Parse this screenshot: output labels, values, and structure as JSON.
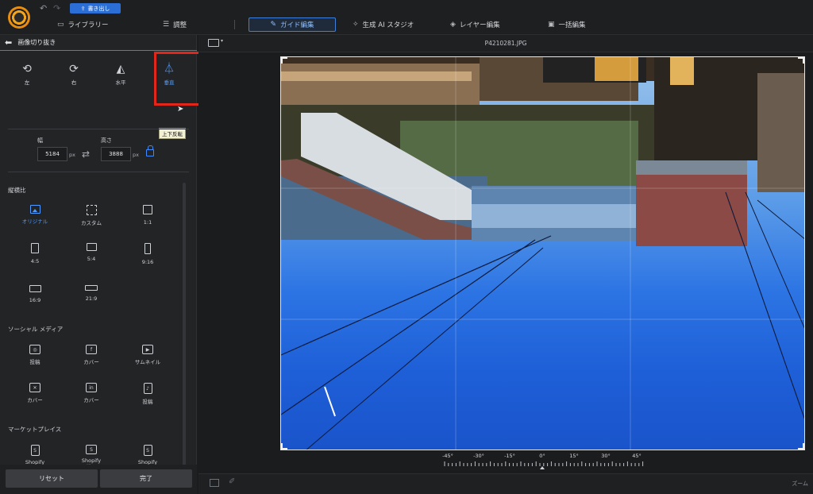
{
  "header": {
    "undo_icon": "↶",
    "redo_icon": "↷",
    "export_label": "書き出し",
    "tabs": [
      {
        "label": "ライブラリー",
        "icon": "library-icon"
      },
      {
        "label": "調整",
        "icon": "sliders-icon"
      },
      {
        "label": "ガイド編集",
        "icon": "wand-icon",
        "active": true
      },
      {
        "label": "生成 AI スタジオ",
        "icon": "sparkle-icon"
      },
      {
        "label": "レイヤー編集",
        "icon": "layers-icon"
      },
      {
        "label": "一括編集",
        "icon": "batch-icon"
      }
    ]
  },
  "left_panel": {
    "title": "画像切り抜き",
    "tools": [
      {
        "label": "左",
        "icon": "rotate-left-icon"
      },
      {
        "label": "右",
        "icon": "rotate-right-icon"
      },
      {
        "label": "水平",
        "icon": "flip-horizontal-icon"
      },
      {
        "label": "垂直",
        "icon": "flip-vertical-icon",
        "active": true
      }
    ],
    "tooltip": "上下反転",
    "width_label": "幅",
    "height_label": "高さ",
    "width_value": "5184",
    "height_value": "3888",
    "unit": "px",
    "aspect_section": "縦横比",
    "aspect_options": [
      {
        "label": "オリジナル",
        "active": true
      },
      {
        "label": "カスタム"
      },
      {
        "label": "1:1"
      },
      {
        "label": "4:5"
      },
      {
        "label": "5:4"
      },
      {
        "label": "9:16"
      },
      {
        "label": "16:9"
      },
      {
        "label": "21:9"
      }
    ],
    "social_section": "ソーシャル メディア",
    "social_options": [
      {
        "label": "投稿"
      },
      {
        "label": "カバー"
      },
      {
        "label": "サムネイル"
      },
      {
        "label": "カバー"
      },
      {
        "label": "カバー"
      },
      {
        "label": "投稿"
      }
    ],
    "market_section": "マーケットプレイス",
    "market_options": [
      {
        "label": "Shopify\n正方形"
      },
      {
        "label": "Shopify\n横長"
      },
      {
        "label": "Shopify\n縦長"
      }
    ],
    "reset_label": "リセット",
    "done_label": "完了"
  },
  "main": {
    "filename": "P4210281.JPG",
    "angle_labels": [
      "-45°",
      "-30°",
      "-15°",
      "0°",
      "15°",
      "30°",
      "45°"
    ],
    "angle_value": 0,
    "zoom_label": "ズーム"
  }
}
